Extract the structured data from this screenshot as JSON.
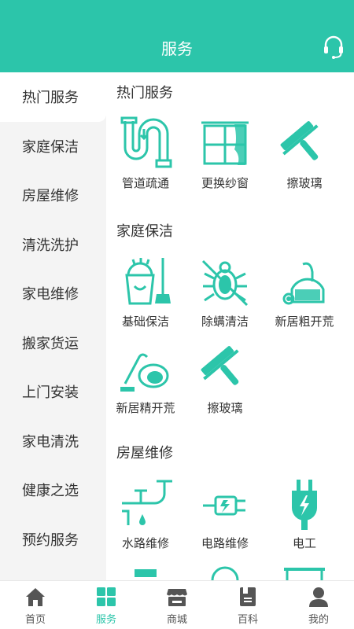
{
  "header": {
    "title": "服务",
    "support_icon": "headset-icon"
  },
  "colors": {
    "accent": "#2cc5aa",
    "icon": "#2cc5aa",
    "sidebar_bg": "#f4f4f4"
  },
  "sidebar": {
    "items": [
      {
        "label": "热门服务",
        "active": true
      },
      {
        "label": "家庭保洁",
        "active": false
      },
      {
        "label": "房屋维修",
        "active": false
      },
      {
        "label": "清洗洗护",
        "active": false
      },
      {
        "label": "家电维修",
        "active": false
      },
      {
        "label": "搬家货运",
        "active": false
      },
      {
        "label": "上门安装",
        "active": false
      },
      {
        "label": "家电清洗",
        "active": false
      },
      {
        "label": "健康之选",
        "active": false
      },
      {
        "label": "预约服务",
        "active": false
      }
    ]
  },
  "sections": [
    {
      "title": "热门服务",
      "services": [
        {
          "label": "管道疏通",
          "icon": "pipe-icon"
        },
        {
          "label": "更换纱窗",
          "icon": "window-curtain-icon"
        },
        {
          "label": "擦玻璃",
          "icon": "squeegee-icon"
        }
      ]
    },
    {
      "title": "家庭保洁",
      "services": [
        {
          "label": "基础保洁",
          "icon": "bucket-mop-icon"
        },
        {
          "label": "除螨清洁",
          "icon": "no-mite-icon"
        },
        {
          "label": "新居粗开荒",
          "icon": "vacuum-icon"
        },
        {
          "label": "新居精开荒",
          "icon": "vacuum-small-icon"
        },
        {
          "label": "擦玻璃",
          "icon": "squeegee-icon"
        }
      ]
    },
    {
      "title": "房屋维修",
      "services": [
        {
          "label": "水路维修",
          "icon": "faucet-icon"
        },
        {
          "label": "电路维修",
          "icon": "plug-icon"
        },
        {
          "label": "电工",
          "icon": "electric-plug-icon"
        }
      ]
    }
  ],
  "tabbar": {
    "tabs": [
      {
        "label": "首页",
        "icon": "home-icon",
        "active": false
      },
      {
        "label": "服务",
        "icon": "grid-icon",
        "active": true
      },
      {
        "label": "商城",
        "icon": "shop-icon",
        "active": false
      },
      {
        "label": "百科",
        "icon": "book-icon",
        "active": false
      },
      {
        "label": "我的",
        "icon": "user-icon",
        "active": false
      }
    ]
  }
}
